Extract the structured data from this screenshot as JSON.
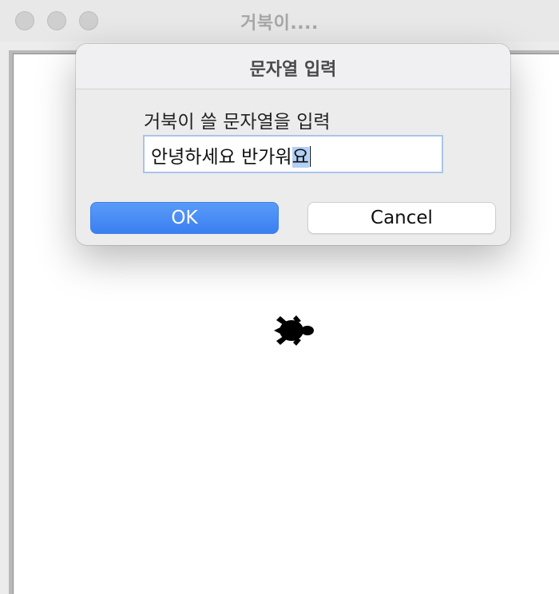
{
  "window": {
    "title": "거북이....",
    "title_color": "#a7a7a7"
  },
  "dialog": {
    "title": "문자열 입력",
    "prompt": "거북이 쓸 문자열을 입력",
    "input_value_before_selection": "안녕하세요 반가워",
    "input_value_selected": "요",
    "ok_label": "OK",
    "cancel_label": "Cancel",
    "accent_color": "#3a7ff2"
  },
  "canvas": {
    "turtle_icon": "turtle-icon"
  }
}
